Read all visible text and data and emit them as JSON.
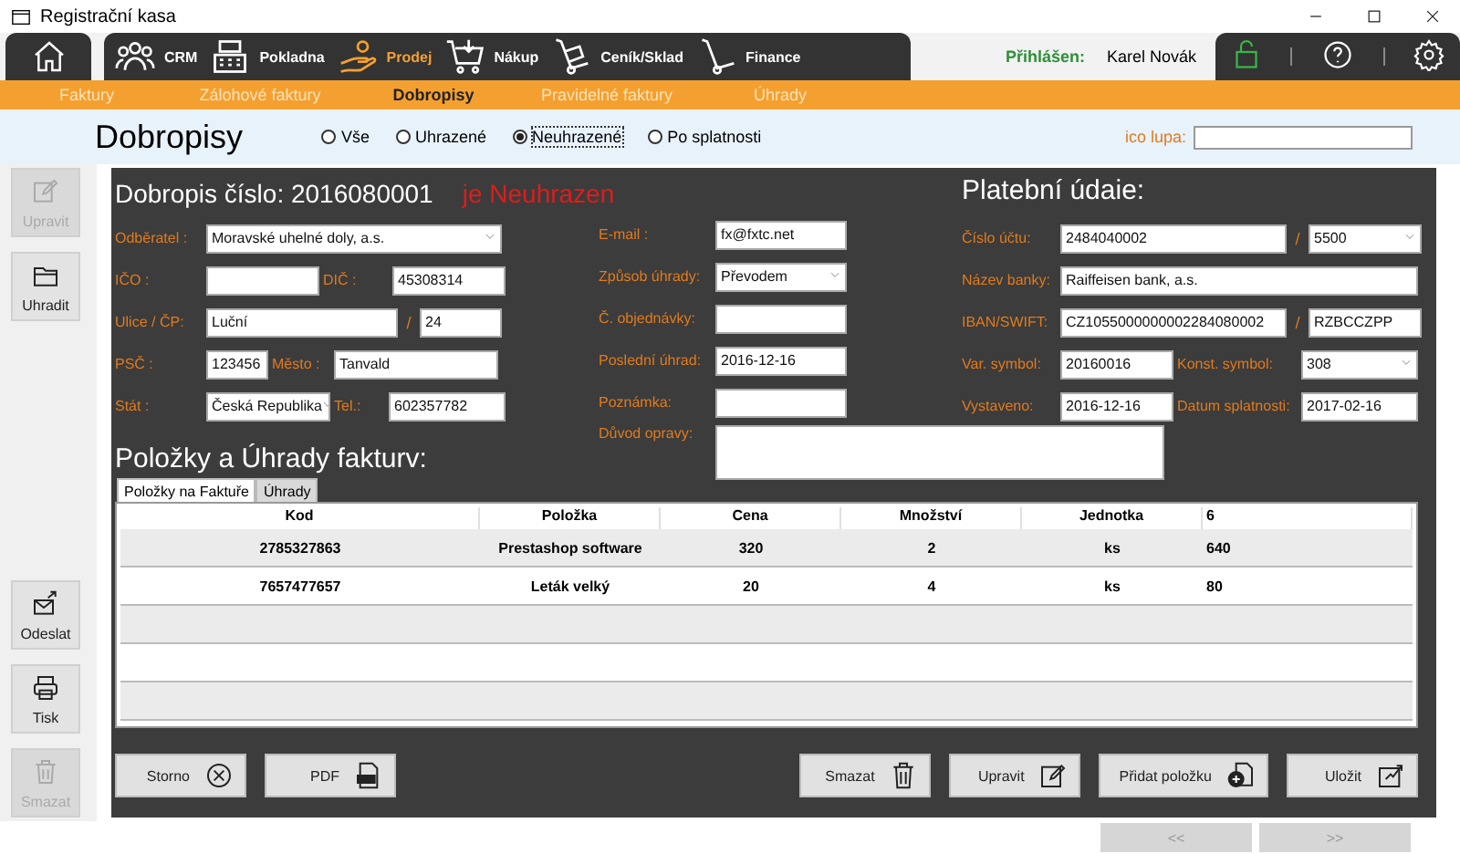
{
  "window": {
    "title": "Registrační kasa"
  },
  "nav": {
    "items": [
      {
        "label": "CRM",
        "selected": false
      },
      {
        "label": "Pokladna",
        "selected": false
      },
      {
        "label": "Prodej",
        "selected": true
      },
      {
        "label": "Nákup",
        "selected": false
      },
      {
        "label": "Ceník/Sklad",
        "selected": false
      },
      {
        "label": "Finance",
        "selected": false
      }
    ],
    "login_label": "Přihlášen:",
    "user": "Karel Novák"
  },
  "subnav": [
    {
      "label": "Faktury",
      "selected": false
    },
    {
      "label": "Zálohové faktury",
      "selected": false
    },
    {
      "label": "Dobropisy",
      "selected": true
    },
    {
      "label": "Pravidelné faktury",
      "selected": false
    },
    {
      "label": "Úhrady",
      "selected": false
    }
  ],
  "header": {
    "title": "Dobropisy",
    "filters": [
      {
        "label": "Vše",
        "selected": false
      },
      {
        "label": "Uhrazené",
        "selected": false
      },
      {
        "label": "Neuhrazené",
        "selected": true
      },
      {
        "label": "Po splatnosti",
        "selected": false
      }
    ],
    "search_label": "ico lupa:"
  },
  "sidebar": {
    "top": [
      {
        "label": "Upravit",
        "disabled": true
      },
      {
        "label": "Uhradit",
        "disabled": false
      }
    ],
    "bottom": [
      {
        "label": "Odeslat",
        "disabled": false
      },
      {
        "label": "Tisk",
        "disabled": false
      },
      {
        "label": "Smazat",
        "disabled": true
      }
    ]
  },
  "document": {
    "title": "Dobropis číslo: 2016080001",
    "status": "je Neuhrazen",
    "payment_heading": "Platební údaie:",
    "customer": [
      [
        {
          "kind": "label",
          "text": "Odběratel :"
        },
        {
          "kind": "select",
          "value": "Moravské uhelné doly, a.s."
        }
      ],
      [
        {
          "kind": "label",
          "text": "IČO :"
        },
        {
          "kind": "input"
        },
        {
          "kind": "label",
          "text": "DIČ :"
        },
        {
          "kind": "input",
          "value": "45308314"
        }
      ],
      [
        {
          "kind": "label",
          "text": "Ulice / ČP:"
        },
        {
          "kind": "input",
          "value": "Luční"
        },
        {
          "kind": "sep",
          "text": "/"
        },
        {
          "kind": "input",
          "value": "24"
        }
      ],
      [
        {
          "kind": "label",
          "text": "PSČ :"
        },
        {
          "kind": "input",
          "value": "123456"
        },
        {
          "kind": "label",
          "text": "Město :"
        },
        {
          "kind": "input",
          "value": "Tanvald"
        }
      ],
      [
        {
          "kind": "label",
          "text": "Stát :"
        },
        {
          "kind": "select",
          "value": "Česká Republika"
        },
        {
          "kind": "label",
          "text": "Tel.:"
        },
        {
          "kind": "input",
          "value": "602357782"
        }
      ]
    ],
    "details": [
      [
        {
          "kind": "label",
          "text": "E-mail :"
        },
        {
          "kind": "input",
          "value": "fx@fxtc.net"
        }
      ],
      [
        {
          "kind": "label",
          "text": "Způsob úhrady:"
        },
        {
          "kind": "select",
          "value": "Převodem"
        }
      ],
      [
        {
          "kind": "label",
          "text": "Č. objednávky:"
        },
        {
          "kind": "input"
        }
      ],
      [
        {
          "kind": "label",
          "text": "Poslední úhrad:"
        },
        {
          "kind": "input",
          "value": "2016-12-16"
        }
      ],
      [
        {
          "kind": "label",
          "text": "Poznámka:"
        },
        {
          "kind": "input"
        }
      ],
      [
        {
          "kind": "label",
          "text": "Důvod opravy:"
        },
        {
          "kind": "textarea"
        }
      ]
    ],
    "payment": [
      [
        {
          "kind": "label",
          "text": "Číslo účtu:"
        },
        {
          "kind": "input",
          "value": "2484040002"
        },
        {
          "kind": "sep",
          "text": "/"
        },
        {
          "kind": "select",
          "value": "5500"
        }
      ],
      [
        {
          "kind": "label",
          "text": "Název banky:"
        },
        {
          "kind": "input",
          "value": "Raiffeisen bank, a.s."
        }
      ],
      [
        {
          "kind": "label",
          "text": "IBAN/SWIFT:"
        },
        {
          "kind": "input",
          "value": "CZ1055000000002284080002"
        },
        {
          "kind": "sep",
          "text": "/"
        },
        {
          "kind": "input",
          "value": "RZBCCZPP"
        }
      ],
      [
        {
          "kind": "label",
          "text": "Var. symbol:"
        },
        {
          "kind": "input",
          "value": "20160016"
        },
        {
          "kind": "label",
          "text": "Konst. symbol:"
        },
        {
          "kind": "select",
          "value": "308"
        }
      ],
      [
        {
          "kind": "label",
          "text": "Vystaveno:"
        },
        {
          "kind": "input",
          "value": "2016-12-16"
        },
        {
          "kind": "label",
          "text": "Datum splatnosti:"
        },
        {
          "kind": "input",
          "value": "2017-02-16"
        }
      ]
    ]
  },
  "items_heading": "Položky a Úhrady fakturv:",
  "tabs": [
    {
      "label": "Položky na Faktuře",
      "selected": true
    },
    {
      "label": "Úhrady",
      "selected": false
    }
  ],
  "table": {
    "columns": [
      "Kod",
      "Položka",
      "Cena",
      "Množství",
      "Jednotka",
      "6"
    ],
    "rows": [
      [
        "2785327863",
        "Prestashop software",
        "320",
        "2",
        "ks",
        "640"
      ],
      [
        "7657477657",
        "Leták velký",
        "20",
        "4",
        "ks",
        "80"
      ]
    ]
  },
  "actions": {
    "left": [
      "Storno",
      "PDF"
    ],
    "right": [
      "Smazat",
      "Upravit",
      "Přidat položku",
      "Uložit"
    ]
  },
  "pager": [
    {
      "label": "<<",
      "disabled": true
    },
    {
      "label": ">>",
      "disabled": true
    }
  ]
}
